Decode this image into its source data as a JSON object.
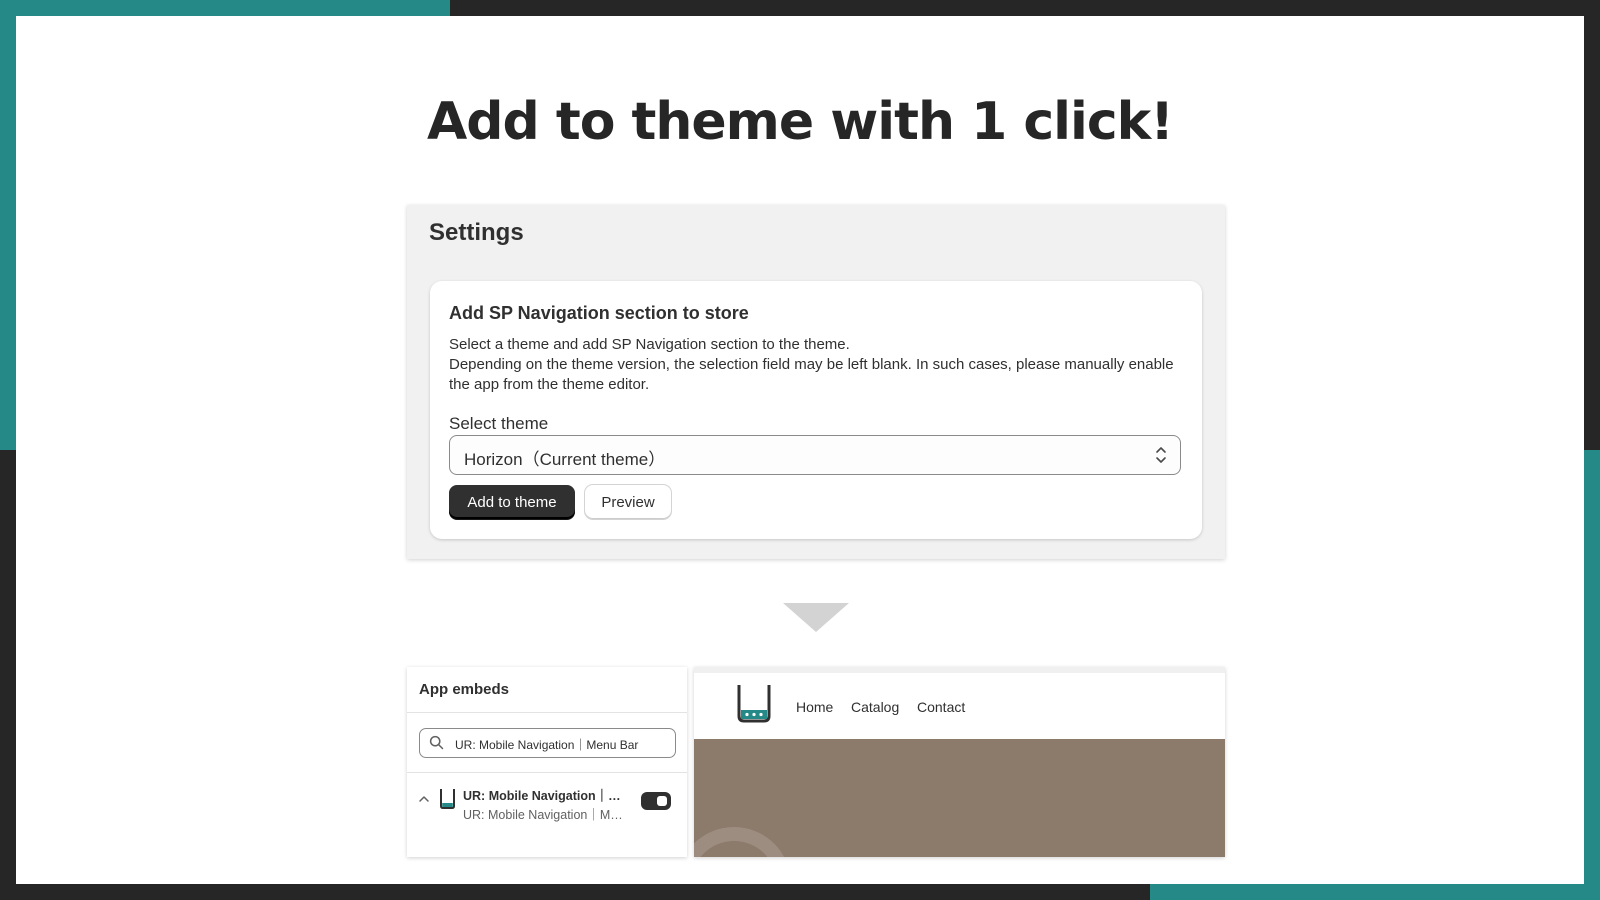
{
  "headline": "Add to theme with 1 click!",
  "colors": {
    "accent_teal": "#258a87",
    "frame_dark": "#262626",
    "primary_button": "#303030",
    "hero_background": "#8c7a6b"
  },
  "settings": {
    "title": "Settings",
    "section": {
      "heading": "Add SP Navigation section to store",
      "description_line1": "Select a theme and add SP Navigation section to the theme.",
      "description_line2": "Depending on the theme version, the selection field may be left blank. In such cases, please manually enable the app from the theme editor.",
      "select_label": "Select theme",
      "select_value": "Horizon（Current theme）",
      "add_button": "Add to theme",
      "preview_button": "Preview"
    }
  },
  "app_embeds": {
    "title": "App embeds",
    "search_value": "UR: Mobile Navigation｜Menu Bar",
    "item": {
      "name": "UR: Mobile Navigation｜Menu Bar",
      "subtitle": "UR: Mobile Navigation｜Menu Bar",
      "enabled": true,
      "icon": "phone-menu-icon"
    }
  },
  "storefront": {
    "logo": "phone-menu-logo",
    "nav": [
      "Home",
      "Catalog",
      "Contact"
    ]
  }
}
